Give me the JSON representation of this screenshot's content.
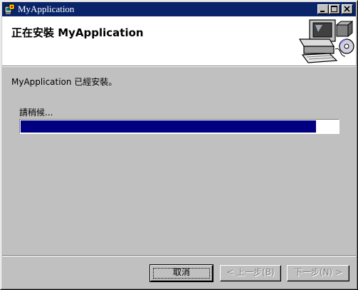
{
  "window": {
    "title": "MyApplication"
  },
  "header": {
    "title": "正在安裝 MyApplication"
  },
  "main": {
    "status": "MyApplication 已經安裝。",
    "wait_label": "請稍候...",
    "progress_fraction": 0.93
  },
  "footer": {
    "cancel_label": "取消",
    "back_label": "< 上一步(B)",
    "next_label": "下一步(N) >"
  },
  "colors": {
    "titlebar": "#0a246a",
    "progress_fill": "#000080",
    "face": "#c0c0c0"
  }
}
